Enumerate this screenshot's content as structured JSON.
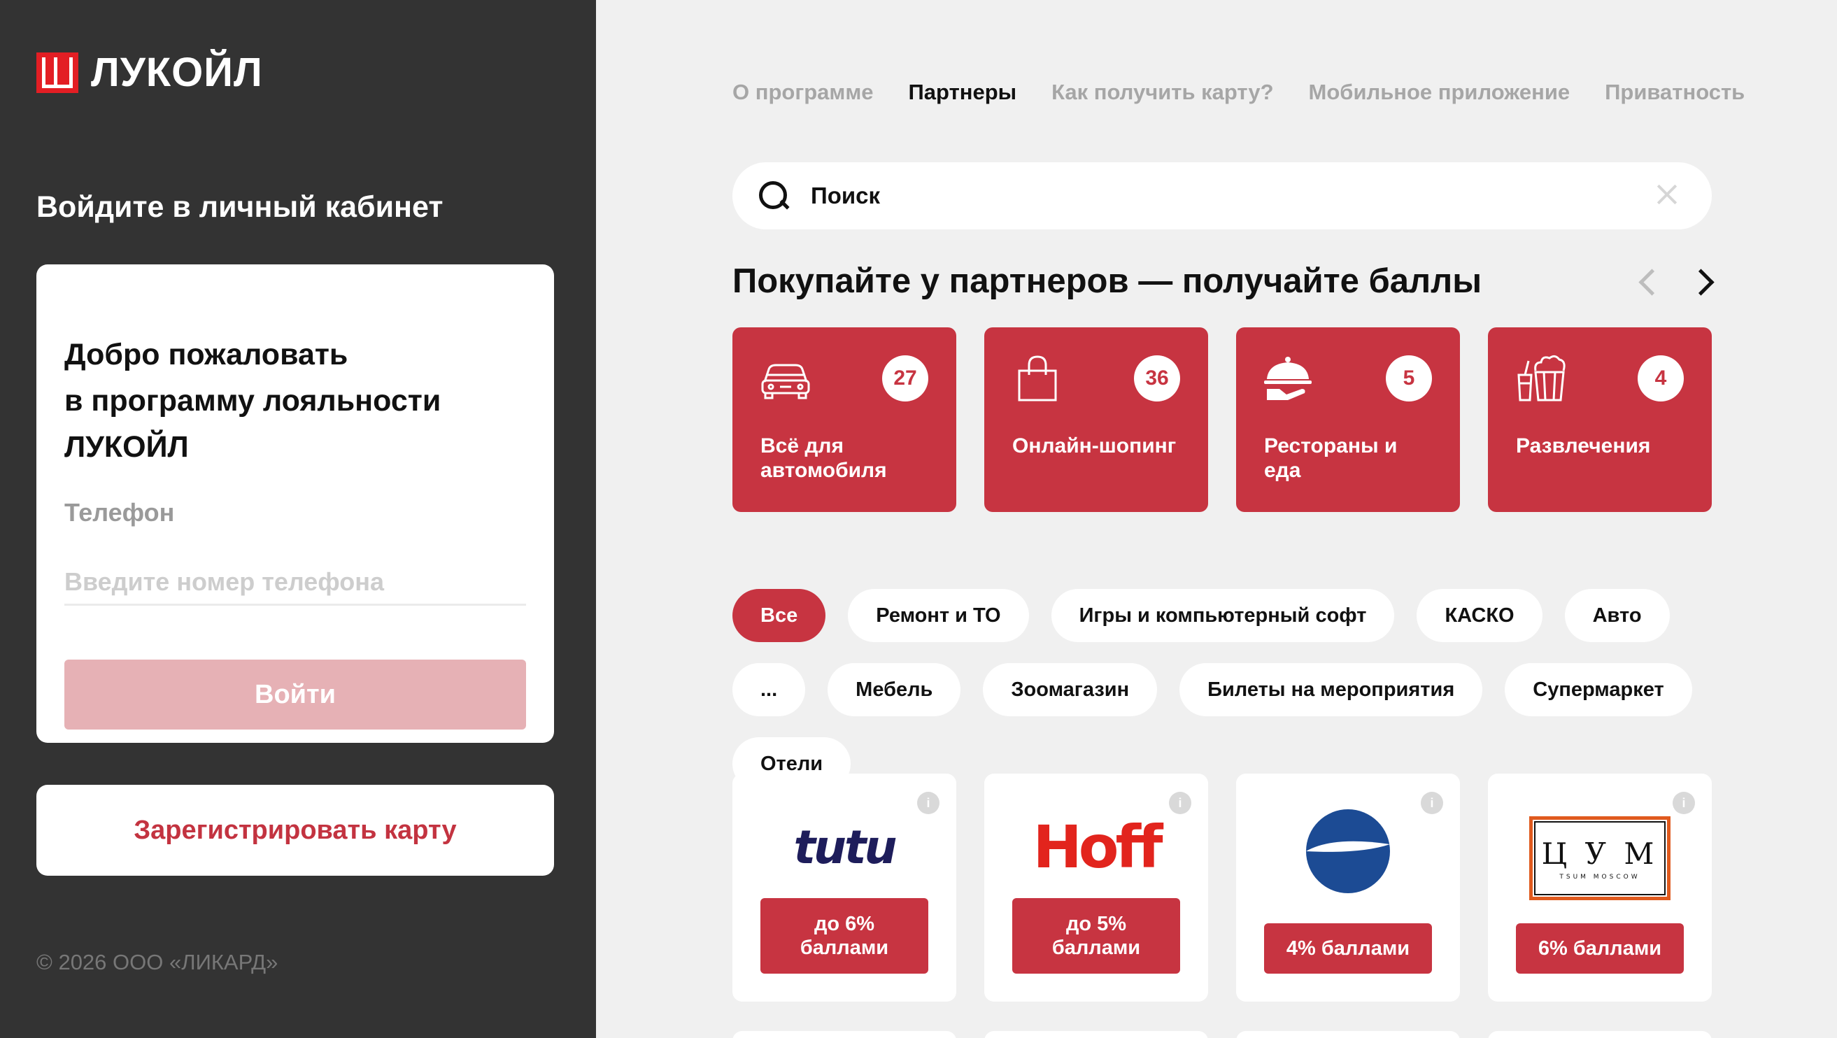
{
  "brand": {
    "name": "ЛУКОЙЛ",
    "color": "#e31e24"
  },
  "sidebar": {
    "login_title": "Войдите в личный кабинет",
    "welcome_line1": "Добро пожаловать",
    "welcome_line2": "в программу лояльности",
    "welcome_line3": "ЛУКОЙЛ",
    "phone_label": "Телефон",
    "phone_placeholder": "Введите номер телефона",
    "login_button": "Войти",
    "register_button": "Зарегистрировать карту",
    "copyright": "© 2026 ООО «ЛИКАРД»"
  },
  "nav": {
    "items": [
      "О программе",
      "Партнеры",
      "Как получить карту?",
      "Мобильное приложение",
      "Приватность"
    ],
    "active": "Партнеры"
  },
  "search": {
    "placeholder": "Поиск"
  },
  "section": {
    "title": "Покупайте у партнеров — получайте баллы"
  },
  "categories": [
    {
      "label": "Всё для автомобиля",
      "count": "27",
      "icon": "car-icon"
    },
    {
      "label": "Онлайн-шопинг",
      "count": "36",
      "icon": "shopping-bag-icon"
    },
    {
      "label": "Рестораны и еда",
      "count": "5",
      "icon": "cloche-icon"
    },
    {
      "label": "Развлечения",
      "count": "4",
      "icon": "popcorn-icon"
    }
  ],
  "filters": [
    "Все",
    "Ремонт и ТО",
    "Игры и компьютерный софт",
    "КАСКО",
    "Авто",
    "...",
    "Мебель",
    "Зоомагазин",
    "Билеты на мероприятия",
    "Супермаркет",
    "Отели"
  ],
  "active_filter": "Все",
  "partners": [
    {
      "logo_text": "tutu",
      "bonus_line1": "до 6%",
      "bonus_line2": "баллами"
    },
    {
      "logo_text": "Hoff",
      "bonus_line1": "до 5%",
      "bonus_line2": "баллами"
    },
    {
      "logo_text": "",
      "bonus_line1": "4% баллами",
      "bonus_line2": ""
    },
    {
      "logo_text": "Ц У М",
      "logo_subtext": "TSUM MOSCOW",
      "bonus_line1": "6% баллами",
      "bonus_line2": ""
    }
  ],
  "colors": {
    "accent": "#c73441",
    "sidebar_bg": "#333333",
    "page_bg": "#f0f0f0"
  }
}
